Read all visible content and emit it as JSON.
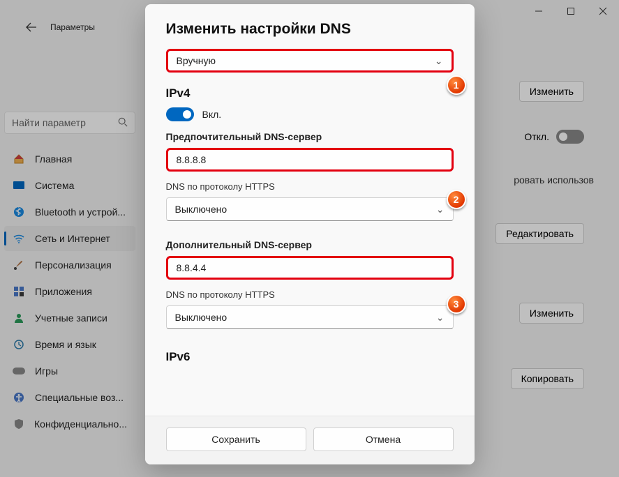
{
  "header": {
    "title": "Параметры"
  },
  "search": {
    "placeholder": "Найти параметр"
  },
  "sidebar": {
    "items": [
      {
        "label": "Главная"
      },
      {
        "label": "Система"
      },
      {
        "label": "Bluetooth и устрой..."
      },
      {
        "label": "Сеть и Интернет"
      },
      {
        "label": "Персонализация"
      },
      {
        "label": "Приложения"
      },
      {
        "label": "Учетные записи"
      },
      {
        "label": "Время и язык"
      },
      {
        "label": "Игры"
      },
      {
        "label": "Специальные воз..."
      },
      {
        "label": "Конфиденциально..."
      }
    ]
  },
  "rightcol": {
    "edit1": "Изменить",
    "off_label": "Откл.",
    "use": "ровать использов",
    "edit2": "Редактировать",
    "edit3": "Изменить",
    "copy": "Копировать"
  },
  "modal": {
    "title": "Изменить настройки DNS",
    "mode_select": "Вручную",
    "ipv4_heading": "IPv4",
    "ipv4_on": "Вкл.",
    "pref_label": "Предпочтительный DNS-сервер",
    "pref_value": "8.8.8.8",
    "doh_label": "DNS по протоколу HTTPS",
    "doh_value": "Выключено",
    "alt_label": "Дополнительный DNS-сервер",
    "alt_value": "8.8.4.4",
    "doh2_label": "DNS по протоколу HTTPS",
    "doh2_value": "Выключено",
    "ipv6_heading": "IPv6",
    "save": "Сохранить",
    "cancel": "Отмена"
  },
  "badges": {
    "b1": "1",
    "b2": "2",
    "b3": "3"
  }
}
